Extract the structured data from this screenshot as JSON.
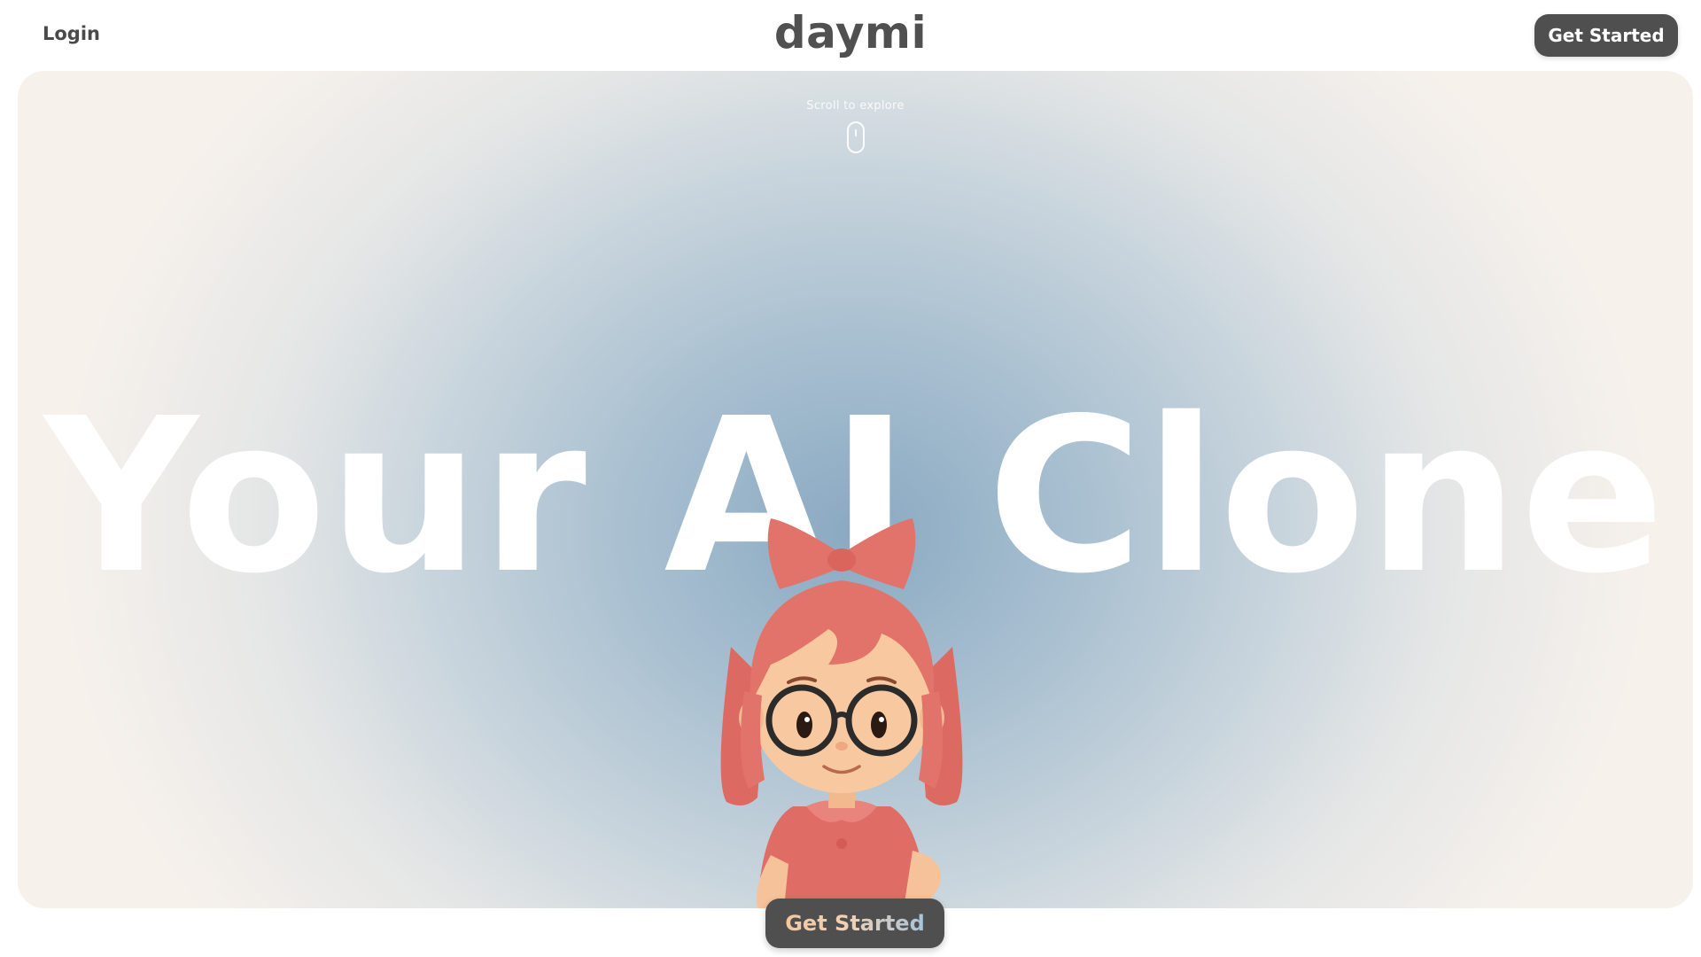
{
  "header": {
    "login_label": "Login",
    "logo_text": "daymi",
    "cta_label": "Get Started"
  },
  "hero": {
    "scroll_hint": "Scroll to explore",
    "title": "Your AI Clone",
    "avatar_icon": "avatar-girl-illustration",
    "cta_label": "Get Started"
  },
  "colors": {
    "button_bg": "#4f4f4f",
    "hero_center": "#8aa9c2",
    "hero_edge": "#f7f1ec",
    "avatar_hair": "#e2736b"
  }
}
